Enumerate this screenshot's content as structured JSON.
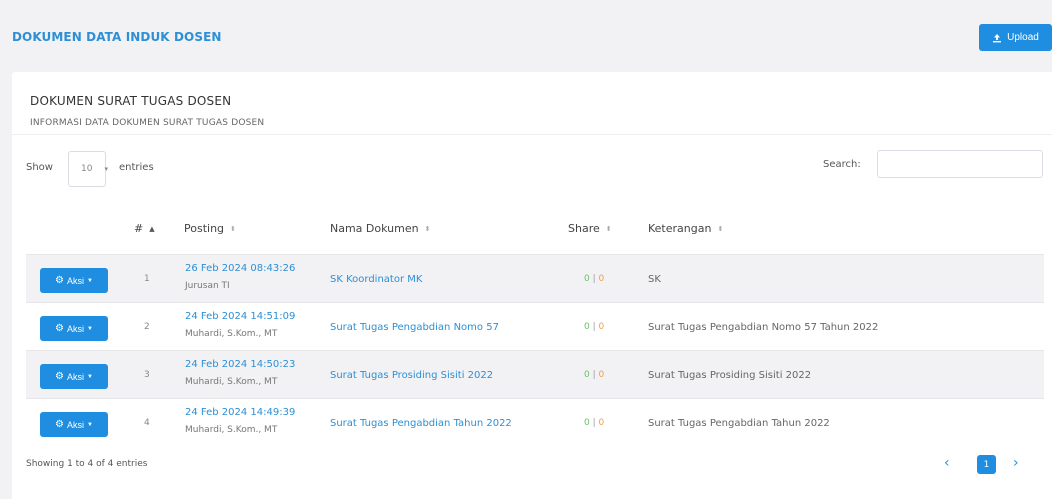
{
  "header": {
    "title": "DOKUMEN DATA INDUK DOSEN",
    "upload_label": "Upload"
  },
  "card": {
    "title": "DOKUMEN SURAT TUGAS DOSEN",
    "subtitle": "INFORMASI DATA DOKUMEN SURAT TUGAS DOSEN"
  },
  "controls": {
    "show_label": "Show",
    "entries_value": "10",
    "entries_label": "entries",
    "search_label": "Search:",
    "search_value": ""
  },
  "table": {
    "columns": [
      "#",
      "Posting",
      "Nama Dokumen",
      "Share",
      "Keterangan"
    ],
    "action_label": "Aksi",
    "rows": [
      {
        "no": "1",
        "date": "26 Feb 2024 08:43:26",
        "user": "Jurusan TI",
        "doc": "SK Koordinator MK",
        "share_a": "0",
        "share_b": "0",
        "ket": "SK"
      },
      {
        "no": "2",
        "date": "24 Feb 2024 14:51:09",
        "user": "Muhardi, S.Kom., MT",
        "doc": "Surat Tugas Pengabdian Nomo 57",
        "share_a": "0",
        "share_b": "0",
        "ket": "Surat Tugas Pengabdian Nomo 57 Tahun 2022"
      },
      {
        "no": "3",
        "date": "24 Feb 2024 14:50:23",
        "user": "Muhardi, S.Kom., MT",
        "doc": "Surat Tugas Prosiding Sisiti 2022",
        "share_a": "0",
        "share_b": "0",
        "ket": "Surat Tugas Prosiding Sisiti 2022"
      },
      {
        "no": "4",
        "date": "24 Feb 2024 14:49:39",
        "user": "Muhardi, S.Kom., MT",
        "doc": "Surat Tugas Pengabdian Tahun 2022",
        "share_a": "0",
        "share_b": "0",
        "ket": "Surat Tugas Pengabdian Tahun 2022"
      }
    ]
  },
  "footer": {
    "info": "Showing 1 to 4 of 4 entries",
    "prev": "‹",
    "current_page": "1",
    "next": "›"
  },
  "colors": {
    "accent": "#1f8ee0",
    "link": "#2d8fd5",
    "share_a": "#6cbf6c",
    "share_b": "#f0a13e"
  }
}
